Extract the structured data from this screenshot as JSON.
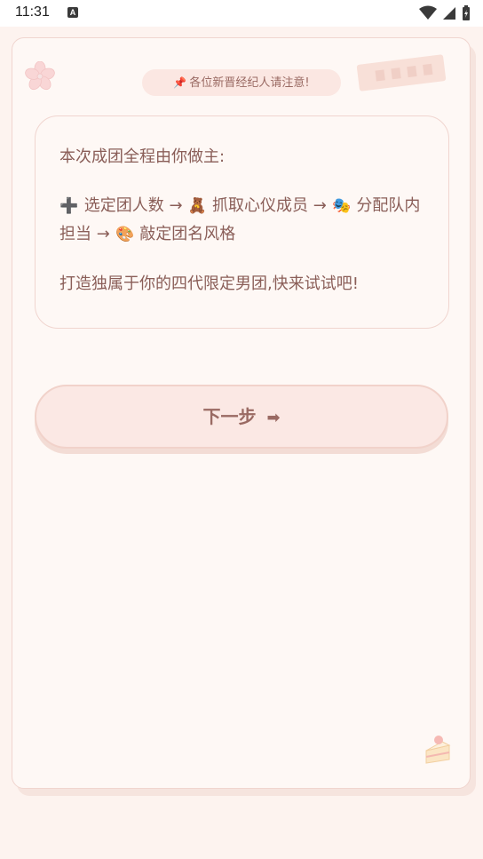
{
  "status_bar": {
    "time": "11:31",
    "notification_icon": "A"
  },
  "notice": {
    "pin_icon": "📌",
    "text": "各位新晋经纪人请注意!"
  },
  "intro": {
    "line1": "本次成团全程由你做主:",
    "steps": [
      {
        "icon": "➕",
        "text": "选定团人数"
      },
      {
        "icon": "🧸",
        "text": "抓取心仪成员"
      },
      {
        "icon": "🎭",
        "text": "分配队内担当"
      },
      {
        "icon": "🎨",
        "text": "敲定团名风格"
      }
    ],
    "arrow": "→",
    "line3": "打造独属于你的四代限定男团,快来试试吧!"
  },
  "next_button": {
    "label": "下一步",
    "arrow": "➡"
  },
  "icons": [
    "sakura-icon",
    "ticket-icon",
    "cake-icon",
    "wifi-icon",
    "signal-icon",
    "battery-icon"
  ]
}
